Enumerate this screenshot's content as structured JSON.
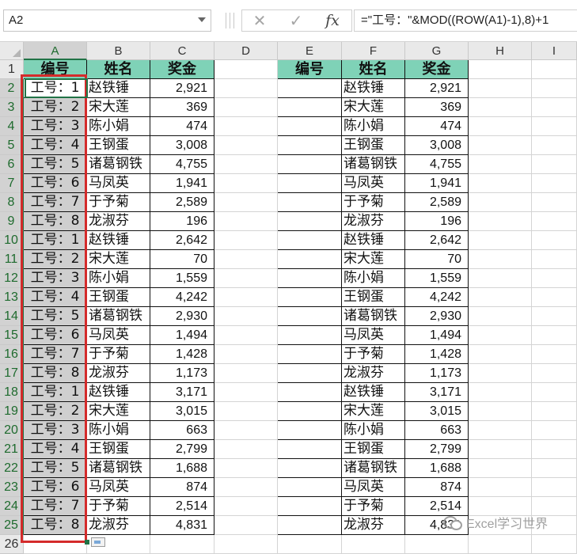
{
  "name_box": "A2",
  "formula": "=\"工号：\"&MOD((ROW(A1)-1),8)+1",
  "formula_buttons": {
    "cancel": "✕",
    "enter": "✓",
    "function": "fx"
  },
  "columns": [
    "A",
    "B",
    "C",
    "D",
    "E",
    "F",
    "G",
    "H",
    "I"
  ],
  "selected_column": "A",
  "rows": [
    "1",
    "2",
    "3",
    "4",
    "5",
    "6",
    "7",
    "8",
    "9",
    "10",
    "11",
    "12",
    "13",
    "14",
    "15",
    "16",
    "17",
    "18",
    "19",
    "20",
    "21",
    "22",
    "23",
    "24",
    "25",
    "26"
  ],
  "headers": {
    "id": "编号",
    "name": "姓名",
    "bonus": "奖金"
  },
  "ids": [
    "工号：1",
    "工号：2",
    "工号：3",
    "工号：4",
    "工号：5",
    "工号：6",
    "工号：7",
    "工号：8",
    "工号：1",
    "工号：2",
    "工号：3",
    "工号：4",
    "工号：5",
    "工号：6",
    "工号：7",
    "工号：8",
    "工号：1",
    "工号：2",
    "工号：3",
    "工号：4",
    "工号：5",
    "工号：6",
    "工号：7",
    "工号：8"
  ],
  "names": [
    "赵铁锤",
    "宋大莲",
    "陈小娟",
    "王钢蛋",
    "诸葛钢铁",
    "马凤英",
    "于予菊",
    "龙淑芬",
    "赵铁锤",
    "宋大莲",
    "陈小娟",
    "王钢蛋",
    "诸葛钢铁",
    "马凤英",
    "于予菊",
    "龙淑芬",
    "赵铁锤",
    "宋大莲",
    "陈小娟",
    "王钢蛋",
    "诸葛钢铁",
    "马凤英",
    "于予菊",
    "龙淑芬"
  ],
  "bonuses": [
    "2,921",
    "369",
    "474",
    "3,008",
    "4,755",
    "1,941",
    "2,589",
    "196",
    "2,642",
    "70",
    "1,559",
    "4,242",
    "2,930",
    "1,494",
    "1,428",
    "1,173",
    "3,171",
    "3,015",
    "663",
    "2,799",
    "1,688",
    "874",
    "2,514",
    "4,831"
  ],
  "colors": {
    "header_fill": "#7fd2b7",
    "selection_outline": "#d42b2b",
    "excel_green": "#217346"
  },
  "watermark": "Excel学习世界"
}
